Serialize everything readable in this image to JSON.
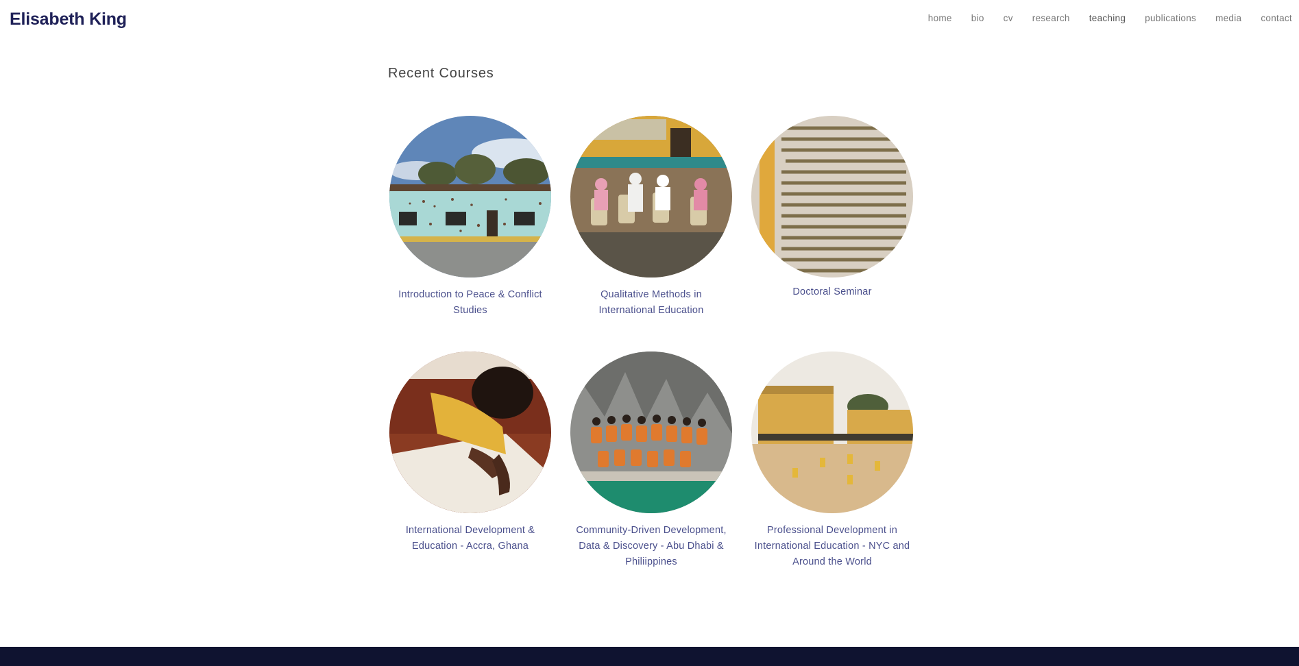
{
  "site": {
    "title": "Elisabeth King"
  },
  "nav": {
    "items": [
      {
        "label": "home"
      },
      {
        "label": "bio"
      },
      {
        "label": "cv"
      },
      {
        "label": "research"
      },
      {
        "label": "teaching",
        "active": true
      },
      {
        "label": "publications"
      },
      {
        "label": "media"
      },
      {
        "label": "contact"
      }
    ]
  },
  "main": {
    "section_title": "Recent Courses",
    "courses": [
      {
        "title": "Introduction to Peace & Conflict Studies",
        "image": "bullet-marked-building-photo"
      },
      {
        "title": "Qualitative Methods in International Education",
        "image": "classroom-group-photo"
      },
      {
        "title": "Doctoral Seminar",
        "image": "right-to-education-text-mural-photo"
      },
      {
        "title": "International Development & Education - Accra, Ghana",
        "image": "child-writing-photo"
      },
      {
        "title": "Community-Driven Development, Data & Discovery - Abu Dhabi & Philiippines",
        "image": "group-life-vests-photo"
      },
      {
        "title": "Professional Development in International Education - NYC and Around the World",
        "image": "schoolyard-photo"
      }
    ]
  },
  "colors": {
    "brand": "#1e2057",
    "link": "#4a4f8c",
    "footer": "#0f1330"
  }
}
